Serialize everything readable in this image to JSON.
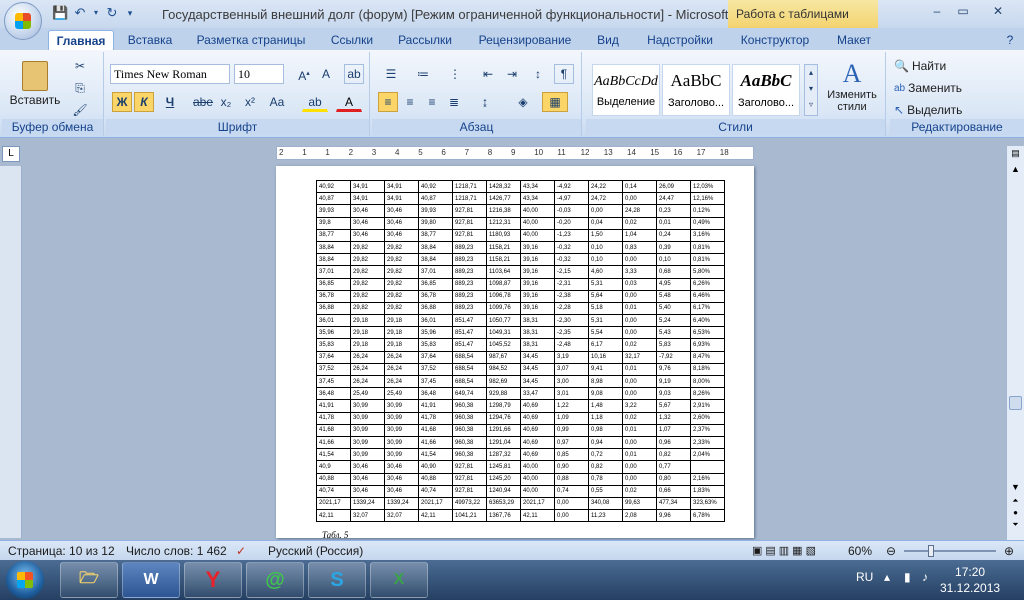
{
  "title": {
    "text": "Государственный внешний долг (форум) [Режим ограниченной функциональности] - Microsoft ...",
    "context_tab": "Работа с таблицами"
  },
  "window_controls": {
    "minimize": "–",
    "maximize": "▭",
    "close": "✕"
  },
  "tabs": [
    "Главная",
    "Вставка",
    "Разметка страницы",
    "Ссылки",
    "Рассылки",
    "Рецензирование",
    "Вид",
    "Надстройки",
    "Конструктор",
    "Макет"
  ],
  "clipboard": {
    "paste": "Вставить",
    "label": "Буфер обмена"
  },
  "font": {
    "name": "Times New Roman",
    "size": "10",
    "label": "Шрифт",
    "bold": "Ж",
    "italic": "К",
    "underline": "Ч",
    "strike": "abe",
    "sub": "x₂",
    "sup": "x²",
    "case": "Aa"
  },
  "paragraph": {
    "label": "Абзац"
  },
  "styles": {
    "label": "Стили",
    "items": [
      {
        "sample": "AaBbCcDd",
        "name": "Выделение"
      },
      {
        "sample": "AaBbC",
        "name": "Заголово..."
      },
      {
        "sample": "AaBbC",
        "name": "Заголово..."
      }
    ],
    "change": "Изменить стили"
  },
  "editing": {
    "find": "Найти",
    "replace": "Заменить",
    "select": "Выделить",
    "label": "Редактирование"
  },
  "ruler": {
    "ticks": [
      "2",
      "1",
      "1",
      "2",
      "3",
      "4",
      "5",
      "6",
      "7",
      "8",
      "9",
      "10",
      "11",
      "12",
      "13",
      "14",
      "15",
      "16",
      "17",
      "18"
    ]
  },
  "table_rows": [
    [
      "40,92",
      "34,91",
      "34,91",
      "40,92",
      "1218,71",
      "1428,32",
      "43,34",
      "-4,92",
      "24,22",
      "0,14",
      "26,09",
      "12,03%"
    ],
    [
      "40,87",
      "34,91",
      "34,91",
      "40,87",
      "1218,71",
      "1426,77",
      "43,34",
      "-4,97",
      "24,72",
      "0,00",
      "24,47",
      "12,16%"
    ],
    [
      "39,93",
      "30,46",
      "30,46",
      "39,93",
      "927,81",
      "1216,38",
      "40,00",
      "-0,03",
      "0,00",
      "24,28",
      "0,23",
      "0,12%"
    ],
    [
      "39,8",
      "30,46",
      "30,46",
      "39,80",
      "927,81",
      "1212,31",
      "40,00",
      "-0,20",
      "0,04",
      "0,02",
      "0,01",
      "0,49%"
    ],
    [
      "38,77",
      "30,46",
      "30,46",
      "38,77",
      "927,81",
      "1180,93",
      "40,00",
      "-1,23",
      "1,50",
      "1,04",
      "0,24",
      "3,16%"
    ],
    [
      "38,84",
      "29,82",
      "29,82",
      "38,84",
      "889,23",
      "1158,21",
      "39,16",
      "-0,32",
      "0,10",
      "0,83",
      "0,39",
      "0,81%"
    ],
    [
      "38,84",
      "29,82",
      "29,82",
      "38,84",
      "889,23",
      "1158,21",
      "39,16",
      "-0,32",
      "0,10",
      "0,00",
      "0,10",
      "0,81%"
    ],
    [
      "37,01",
      "29,82",
      "29,82",
      "37,01",
      "889,23",
      "1103,64",
      "39,16",
      "-2,15",
      "4,60",
      "3,33",
      "0,68",
      "5,80%"
    ],
    [
      "36,85",
      "29,82",
      "29,82",
      "36,85",
      "889,23",
      "1098,87",
      "39,16",
      "-2,31",
      "5,31",
      "0,03",
      "4,95",
      "6,26%"
    ],
    [
      "36,78",
      "29,82",
      "29,82",
      "36,78",
      "889,23",
      "1096,78",
      "39,16",
      "-2,38",
      "5,64",
      "0,00",
      "5,48",
      "6,46%"
    ],
    [
      "36,88",
      "29,82",
      "29,82",
      "36,88",
      "889,23",
      "1099,76",
      "39,16",
      "-2,28",
      "5,18",
      "0,01",
      "5,40",
      "6,17%"
    ],
    [
      "36,01",
      "29,18",
      "29,18",
      "36,01",
      "851,47",
      "1050,77",
      "38,31",
      "-2,30",
      "5,31",
      "0,00",
      "5,24",
      "6,40%"
    ],
    [
      "35,96",
      "29,18",
      "29,18",
      "35,96",
      "851,47",
      "1049,31",
      "38,31",
      "-2,35",
      "5,54",
      "0,00",
      "5,43",
      "6,53%"
    ],
    [
      "35,83",
      "29,18",
      "29,18",
      "35,83",
      "851,47",
      "1045,52",
      "38,31",
      "-2,48",
      "6,17",
      "0,02",
      "5,83",
      "6,93%"
    ],
    [
      "37,64",
      "26,24",
      "26,24",
      "37,64",
      "688,54",
      "987,67",
      "34,45",
      "3,19",
      "10,16",
      "32,17",
      "-7,92",
      "8,47%"
    ],
    [
      "37,52",
      "26,24",
      "26,24",
      "37,52",
      "688,54",
      "984,52",
      "34,45",
      "3,07",
      "9,41",
      "0,01",
      "9,76",
      "8,18%"
    ],
    [
      "37,45",
      "26,24",
      "26,24",
      "37,45",
      "688,54",
      "982,69",
      "34,45",
      "3,00",
      "8,98",
      "0,00",
      "9,19",
      "8,00%"
    ],
    [
      "36,48",
      "25,49",
      "25,49",
      "36,48",
      "649,74",
      "929,88",
      "33,47",
      "3,01",
      "9,08",
      "0,00",
      "9,03",
      "8,26%"
    ],
    [
      "41,91",
      "30,99",
      "30,99",
      "41,91",
      "960,38",
      "1298,79",
      "40,69",
      "1,22",
      "1,48",
      "3,22",
      "5,67",
      "2,91%"
    ],
    [
      "41,78",
      "30,99",
      "30,99",
      "41,78",
      "960,38",
      "1294,76",
      "40,69",
      "1,09",
      "1,18",
      "0,02",
      "1,32",
      "2,60%"
    ],
    [
      "41,68",
      "30,99",
      "30,99",
      "41,68",
      "960,38",
      "1291,66",
      "40,69",
      "0,99",
      "0,98",
      "0,01",
      "1,07",
      "2,37%"
    ],
    [
      "41,66",
      "30,99",
      "30,99",
      "41,66",
      "960,38",
      "1291,04",
      "40,69",
      "0,97",
      "0,94",
      "0,00",
      "0,96",
      "2,33%"
    ],
    [
      "41,54",
      "30,99",
      "30,99",
      "41,54",
      "960,38",
      "1287,32",
      "40,69",
      "0,85",
      "0,72",
      "0,01",
      "0,82",
      "2,04%"
    ],
    [
      "40,9",
      "30,46",
      "30,46",
      "40,90",
      "927,81",
      "1245,81",
      "40,00",
      "0,90",
      "0,82",
      "0,00",
      "0,77",
      ""
    ],
    [
      "40,88",
      "30,46",
      "30,46",
      "40,88",
      "927,81",
      "1245,20",
      "40,00",
      "0,88",
      "0,78",
      "0,00",
      "0,80",
      "2,16%"
    ],
    [
      "40,74",
      "30,46",
      "30,46",
      "40,74",
      "927,81",
      "1240,94",
      "40,00",
      "0,74",
      "0,55",
      "0,02",
      "0,66",
      "1,83%"
    ],
    [
      "2021,17",
      "1339,24",
      "1339,24",
      "2021,17",
      "49973,22",
      "63653,29",
      "2021,17",
      "0,00",
      "340,08",
      "99,63",
      "477,34",
      "323,63%"
    ],
    [
      "42,11",
      "32,07",
      "32,07",
      "42,11",
      "1041,21",
      "1367,76",
      "42,11",
      "0,00",
      "11,23",
      "2,08",
      "9,96",
      "6,78%"
    ]
  ],
  "page_footer_text": "Табл. 5",
  "status": {
    "page": "Страница: 10 из 12",
    "words": "Число слов: 1 462",
    "lang": "Русский (Россия)",
    "zoom": "60%"
  },
  "taskbar": {
    "lang": "RU",
    "time": "17:20",
    "date": "31.12.2013"
  }
}
